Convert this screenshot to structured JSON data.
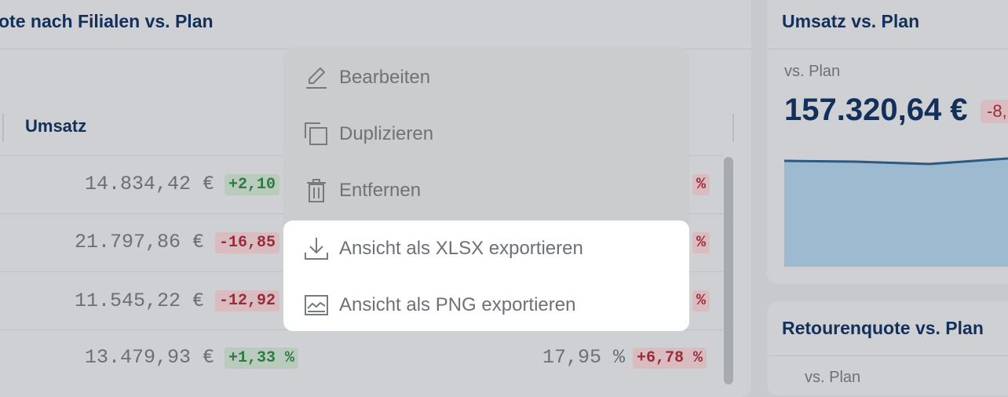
{
  "left_card": {
    "title": "ote nach Filialen vs. Plan",
    "column_header": "Umsatz",
    "rows": [
      {
        "umsatz": "14.834,42 €",
        "umsatz_badge": "+2,10",
        "badge_type": "pos",
        "quote": "",
        "quote_badge": "%",
        "quote_badge_type": "neg"
      },
      {
        "umsatz": "21.797,86 €",
        "umsatz_badge": "-16,85",
        "badge_type": "neg",
        "quote": "",
        "quote_badge": "%",
        "quote_badge_type": "neg"
      },
      {
        "umsatz": "11.545,22 €",
        "umsatz_badge": "-12,92",
        "badge_type": "neg",
        "quote": "",
        "quote_badge": "%",
        "quote_badge_type": "neg"
      },
      {
        "umsatz": "13.479,93 €",
        "umsatz_badge": "+1,33 %",
        "badge_type": "pos",
        "quote": "17,95 %",
        "quote_badge": "+6,78 %",
        "quote_badge_type": "neg"
      }
    ]
  },
  "right_card": {
    "title": "Umsatz vs. Plan",
    "vs_label": "vs. Plan",
    "value": "157.320,64 €",
    "badge": "-8,"
  },
  "right_card2": {
    "title": "Retourenquote vs. Plan",
    "vs_label": "vs. Plan"
  },
  "menu": {
    "items": [
      {
        "label": "Bearbeiten",
        "icon": "pencil-icon"
      },
      {
        "label": "Duplizieren",
        "icon": "duplicate-icon"
      },
      {
        "label": "Entfernen",
        "icon": "trash-icon"
      },
      {
        "label": "Ansicht als XLSX exportieren",
        "icon": "download-icon"
      },
      {
        "label": "Ansicht als PNG exportieren",
        "icon": "image-icon"
      }
    ]
  },
  "colors": {
    "navy": "#12305a",
    "positive": "#2f7a44",
    "negative": "#9a2c3a",
    "area_fill": "#9dbad0"
  }
}
